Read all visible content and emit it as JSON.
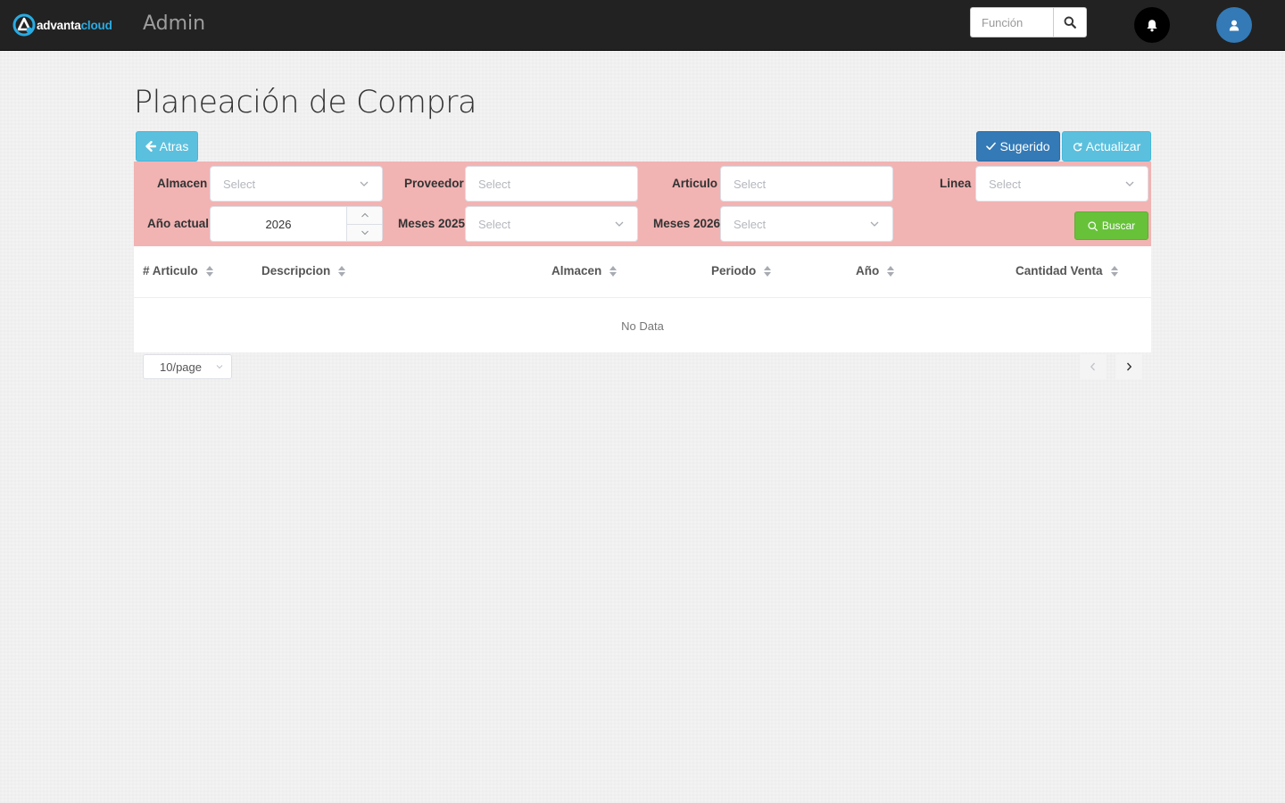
{
  "navbar": {
    "logo_text_a": "advanta",
    "logo_text_b": "cloud",
    "title": "Admin",
    "search_placeholder": "Función"
  },
  "page": {
    "title": "Planeación de Compra",
    "back_label": "Atras",
    "sugerido_label": "Sugerido",
    "actualizar_label": "Actualizar"
  },
  "filters": {
    "almacen_label": "Almacen",
    "almacen_placeholder": "Select",
    "proveedor_label": "Proveedor",
    "proveedor_placeholder": "Select",
    "articulo_label": "Articulo",
    "articulo_placeholder": "Select",
    "linea_label": "Linea",
    "linea_placeholder": "Select",
    "anio_label": "Año actual",
    "anio_value": "2026",
    "meses_prev_label": "Meses 2025",
    "meses_prev_placeholder": "Select",
    "meses_curr_label": "Meses 2026",
    "meses_curr_placeholder": "Select",
    "buscar_label": "Buscar"
  },
  "table": {
    "columns": [
      "# Articulo",
      "Descripcion",
      "Almacen",
      "Periodo",
      "Año",
      "Cantidad Venta"
    ],
    "empty_text": "No Data"
  },
  "pagination": {
    "page_size": "10/page"
  },
  "colors": {
    "navbar": "#222222",
    "filter_panel": "#f2b3b3",
    "info": "#5bc0de",
    "primary": "#337ab7",
    "success": "#67c23a"
  }
}
